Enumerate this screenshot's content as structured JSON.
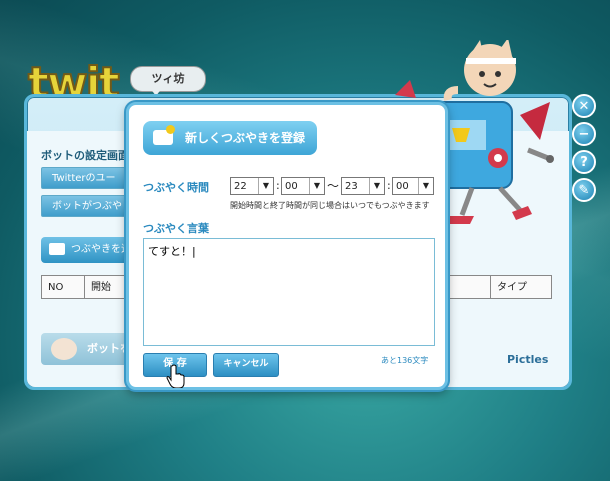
{
  "logo": {
    "text": "twit",
    "speech_bubble": "ツィ坊"
  },
  "main_window": {
    "section_title": "ボットの設定画面",
    "menu_items": [
      "Twitterのユー",
      "ボットがつぶや"
    ],
    "add_tweet_button": "つぶやきを追",
    "table_headers": [
      "NO",
      "開始",
      "タイプ"
    ],
    "bot_start_button": "ボットを",
    "brand": "Pictles"
  },
  "side_buttons": [
    {
      "icon": "close-icon",
      "glyph": "✕"
    },
    {
      "icon": "minimize-icon",
      "glyph": "−"
    },
    {
      "icon": "help-icon",
      "glyph": "?"
    },
    {
      "icon": "edit-icon",
      "glyph": "✎"
    }
  ],
  "dialog": {
    "title": "新しくつぶやきを登録",
    "time_label": "つぶやく時間",
    "start_hour": "22",
    "start_minute": "00",
    "end_hour": "23",
    "end_minute": "00",
    "colon": ":",
    "tilde": "～",
    "time_note": "開始時間と終了時間が同じ場合はいつでもつぶやきます",
    "words_label": "つぶやく言葉",
    "tweet_text": "てすと！|",
    "save_button": "保 存",
    "cancel_button": "キャンセル",
    "remaining_chars": "あと136文字"
  },
  "colors": {
    "accent": "#3ea5d6",
    "label": "#2b8abf",
    "desktop": "#1f7f86"
  }
}
